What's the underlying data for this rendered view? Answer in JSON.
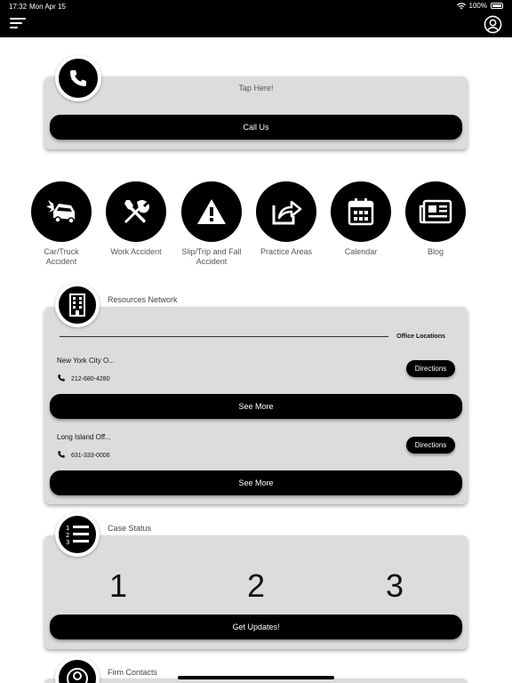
{
  "status_bar": {
    "time": "17:32",
    "date": "Mon Apr 15",
    "battery": "100%"
  },
  "call_card": {
    "hint": "Tap Here!",
    "button_label": "Call Us"
  },
  "quick_links": [
    {
      "label": "Car/Truck Accident",
      "icon": "car-crash-icon"
    },
    {
      "label": "Work Accident",
      "icon": "tools-icon"
    },
    {
      "label": "Slip/Trip and Fall Accident",
      "icon": "warning-icon"
    },
    {
      "label": "Practice Areas",
      "icon": "share-icon"
    },
    {
      "label": "Calendar",
      "icon": "calendar-icon"
    },
    {
      "label": "Blog",
      "icon": "newspaper-icon"
    }
  ],
  "resources": {
    "title": "Resources Network",
    "section_label": "Office Locations",
    "locations": [
      {
        "name": "New York City O...",
        "phone": "212-680-4280",
        "directions_label": "Directions",
        "see_more_label": "See More"
      },
      {
        "name": "Long Island Off...",
        "phone": "631-333-0006",
        "directions_label": "Directions",
        "see_more_label": "See More"
      }
    ]
  },
  "case_status": {
    "title": "Case Status",
    "steps": [
      "1",
      "2",
      "3"
    ],
    "button_label": "Get Updates!"
  },
  "firm_contacts": {
    "title": "Firm Contacts"
  }
}
